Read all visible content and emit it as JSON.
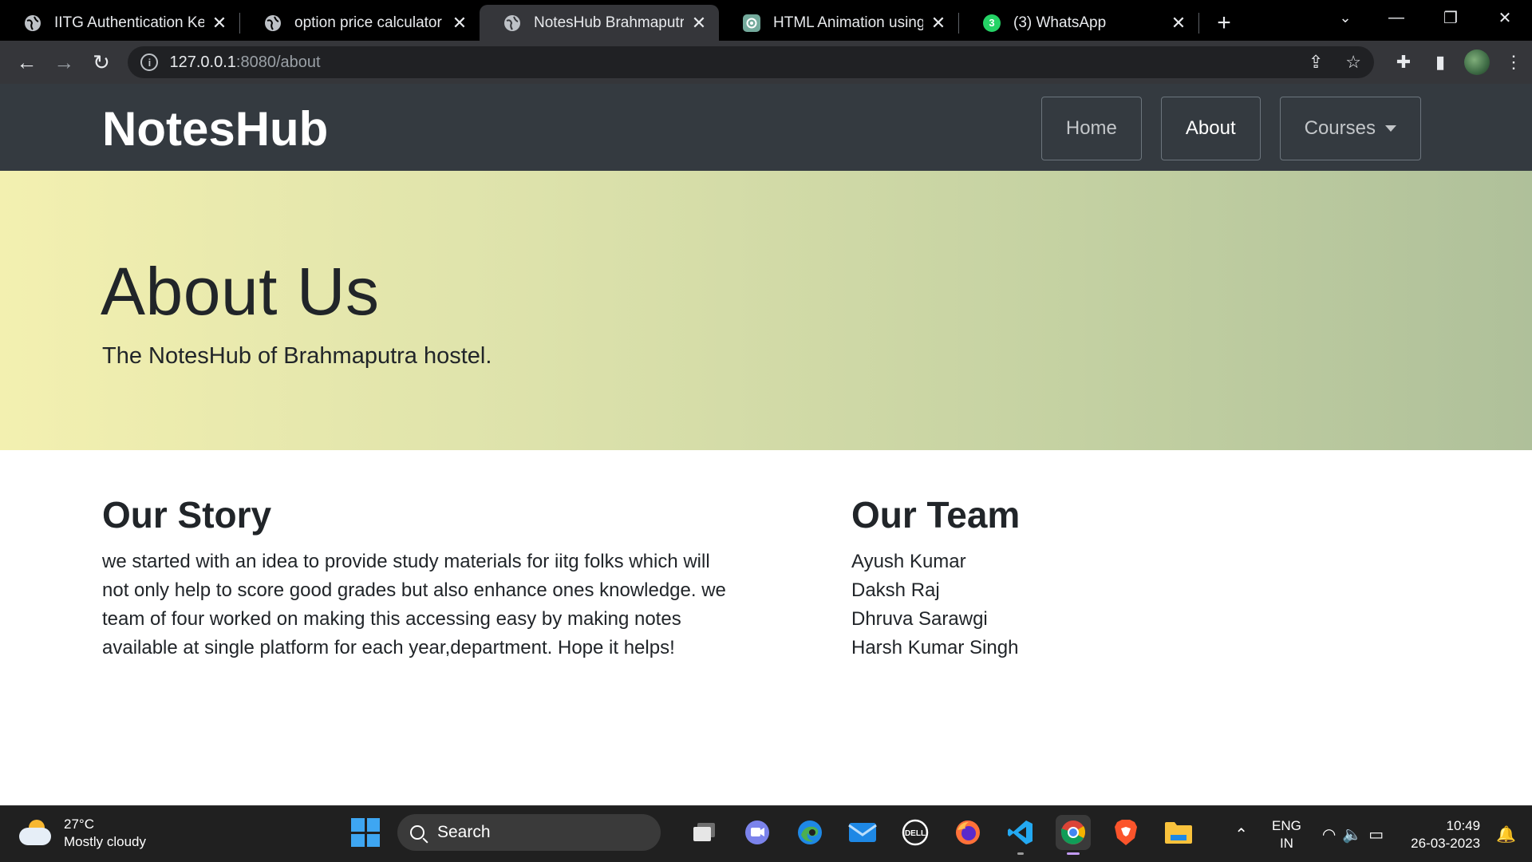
{
  "browser": {
    "tabs": [
      {
        "title": "IITG Authentication Keepa",
        "active": false,
        "favicon": "globe-icon"
      },
      {
        "title": "option price calculator",
        "active": false,
        "favicon": "globe-icon"
      },
      {
        "title": "NotesHub Brahmaputra",
        "active": true,
        "favicon": "globe-icon"
      },
      {
        "title": "HTML Animation using CS",
        "active": false,
        "favicon": "chatgpt-icon"
      },
      {
        "title": "(3) WhatsApp",
        "active": false,
        "favicon": "whatsapp-icon",
        "badge": "3"
      }
    ],
    "url_host": "127.0.0.1",
    "url_path": ":8080/about"
  },
  "site": {
    "brand": "NotesHub",
    "nav": {
      "home": "Home",
      "about": "About",
      "courses": "Courses"
    },
    "hero": {
      "title": "About Us",
      "subtitle": "The NotesHub of Brahmaputra hostel."
    },
    "story": {
      "heading": "Our Story",
      "text": "we started with an idea to provide study materials for iitg folks which will not only help to score good grades but also enhance ones knowledge. we team of four worked on making this accessing easy by making notes available at single platform for each year,department. Hope it helps!"
    },
    "team": {
      "heading": "Our Team",
      "members": [
        "Ayush Kumar",
        "Daksh Raj",
        "Dhruva Sarawgi",
        "Harsh Kumar Singh"
      ]
    }
  },
  "taskbar": {
    "weather_temp": "27°C",
    "weather_desc": "Mostly cloudy",
    "search_label": "Search",
    "lang_top": "ENG",
    "lang_bottom": "IN",
    "time": "10:49",
    "date": "26-03-2023"
  },
  "colors": {
    "navbar": "#343a40",
    "hero_start": "#f3f0b0",
    "hero_end": "#afc09a"
  }
}
